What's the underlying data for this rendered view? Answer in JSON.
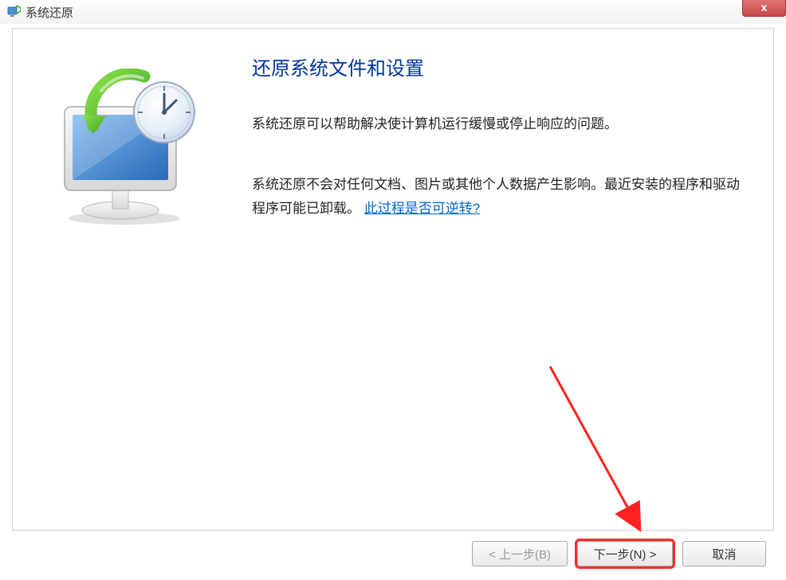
{
  "window": {
    "title": "系统还原",
    "close_label": "x"
  },
  "content": {
    "heading": "还原系统文件和设置",
    "para1": "系统还原可以帮助解决使计算机运行缓慢或停止响应的问题。",
    "para2_part1": "系统还原不会对任何文档、图片或其他个人数据产生影响。最近安装的程序和驱动程序可能已卸载。",
    "para2_link": "此过程是否可逆转?"
  },
  "buttons": {
    "back": "< 上一步(B)",
    "next": "下一步(N) >",
    "cancel": "取消"
  }
}
